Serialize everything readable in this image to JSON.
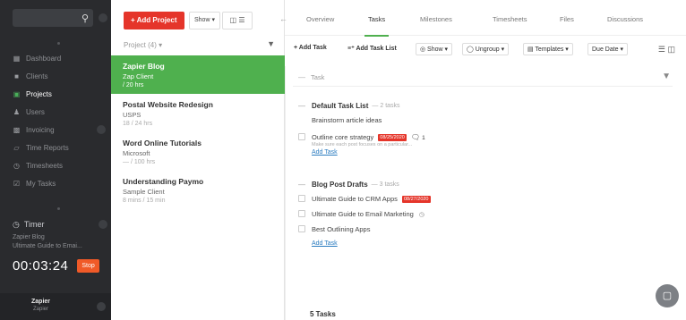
{
  "sidebar": {
    "search_placeholder": "",
    "nav": [
      {
        "label": "Dashboard",
        "icon": "dashboard-icon",
        "active": false
      },
      {
        "label": "Clients",
        "icon": "clients-icon",
        "active": false
      },
      {
        "label": "Projects",
        "icon": "projects-icon",
        "active": true
      },
      {
        "label": "Users",
        "icon": "users-icon",
        "active": false
      },
      {
        "label": "Invoicing",
        "icon": "invoicing-icon",
        "active": false
      },
      {
        "label": "Time Reports",
        "icon": "time-reports-icon",
        "active": false
      },
      {
        "label": "Timesheets",
        "icon": "timesheets-icon",
        "active": false
      },
      {
        "label": "My Tasks",
        "icon": "my-tasks-icon",
        "active": false
      }
    ],
    "timer": {
      "label": "Timer",
      "project": "Zapier Blog",
      "task": "Ultimate Guide to Emai...",
      "time": "00:03:24",
      "stop_label": "Stop"
    },
    "user": {
      "name": "Zapier",
      "company": "Zapier"
    }
  },
  "projects": {
    "add_label": "+ Add Project",
    "show_label": "Show ▾",
    "header": "Project (4) ▾",
    "items": [
      {
        "name": "Zapier Blog",
        "client": "Zap Client",
        "hours": "/ 20 hrs",
        "active": true
      },
      {
        "name": "Postal Website Redesign",
        "client": "USPS",
        "hours": "18 / 24 hrs",
        "active": false
      },
      {
        "name": "Word Online Tutorials",
        "client": "Microsoft",
        "hours": "— / 100 hrs",
        "active": false
      },
      {
        "name": "Understanding Paymo",
        "client": "Sample Client",
        "hours": "8 mins / 15 min",
        "active": false
      }
    ]
  },
  "tabs": [
    "Overview",
    "Tasks",
    "Milestones",
    "Timesheets",
    "Files",
    "Discussions"
  ],
  "active_tab": "Tasks",
  "toolbar": {
    "add_task": "+ Add Task",
    "add_task_list": "≡⁺ Add Task List",
    "show": "◎ Show ▾",
    "ungroup": "◯ Ungroup ▾",
    "templates": "▤ Templates ▾",
    "due_date": "Due Date ▾"
  },
  "filter": {
    "placeholder": "Task"
  },
  "task_lists": [
    {
      "name": "Default Task List",
      "count": "— 2 tasks",
      "tasks": [
        {
          "name": "Brainstorm article ideas",
          "checkbox": false
        },
        {
          "name": "Outline core strategy",
          "checkbox": true,
          "tag": "08/25/2020",
          "comments": "1",
          "desc": "Make sure each post focuses on a particular..."
        }
      ],
      "add_label": "Add Task"
    },
    {
      "name": "Blog Post Drafts",
      "count": "— 3 tasks",
      "tasks": [
        {
          "name": "Ultimate Guide to CRM Apps",
          "checkbox": true,
          "tag": "08/27/2020"
        },
        {
          "name": "Ultimate Guide to Email Marketing",
          "checkbox": true,
          "clock": true
        },
        {
          "name": "Best Outlining Apps",
          "checkbox": true
        }
      ],
      "add_label": "Add Task"
    }
  ],
  "footer": {
    "count": "5 Tasks"
  },
  "colors": {
    "accent_green": "#4fb04e",
    "accent_red": "#e5352a",
    "stop_orange": "#f05a28",
    "sidebar_bg": "#2a2b2e"
  }
}
